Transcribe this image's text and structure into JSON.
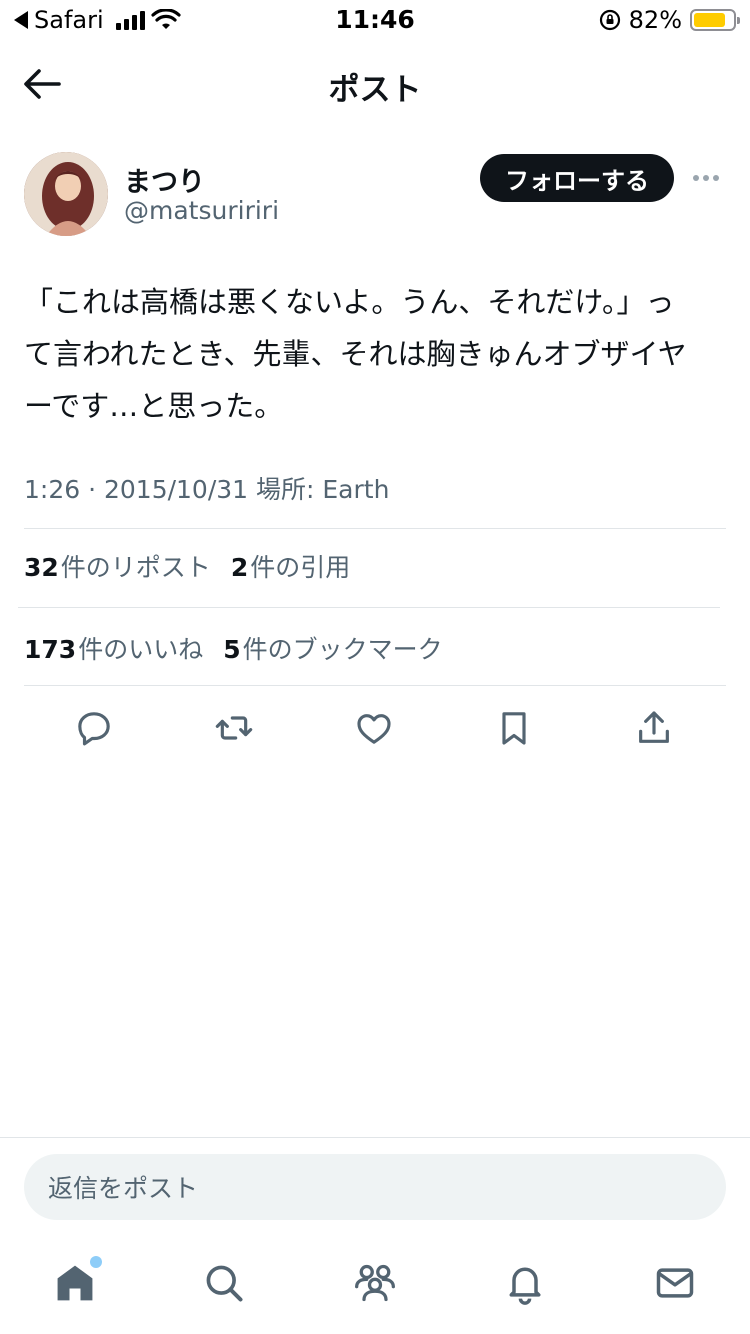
{
  "status_bar": {
    "back_app": "Safari",
    "time": "11:46",
    "battery_percent": "82%",
    "battery_level": 0.82
  },
  "header": {
    "title": "ポスト"
  },
  "author": {
    "display_name": "まつり",
    "handle": "@matsuririri",
    "follow_label": "フォローする"
  },
  "tweet": {
    "lines": [
      "「これは高橋は悪くないよ。うん、それだけ。」っ",
      "て言われたとき、先輩、それは胸きゅんオブザイヤ",
      "ーです…と思った。"
    ],
    "meta": "1:26 · 2015/10/31 場所: Earth"
  },
  "stats": {
    "reposts_count": "32",
    "reposts_label": "件のリポスト",
    "quotes_count": "2",
    "quotes_label": "件の引用",
    "likes_count": "173",
    "likes_label": "件のいいね",
    "bookmarks_count": "5",
    "bookmarks_label": "件のブックマーク"
  },
  "actions": [
    "reply-icon",
    "repost-icon",
    "like-icon",
    "bookmark-icon",
    "share-icon"
  ],
  "reply": {
    "placeholder": "返信をポスト"
  },
  "tabbar": [
    "home-icon",
    "search-icon",
    "communities-icon",
    "notifications-icon",
    "messages-icon"
  ],
  "colors": {
    "text": "#0f1419",
    "secondary": "#536471",
    "follow_bg": "#0f1419",
    "battery": "#ffcc00",
    "notif_dot": "#8ecdf8"
  }
}
